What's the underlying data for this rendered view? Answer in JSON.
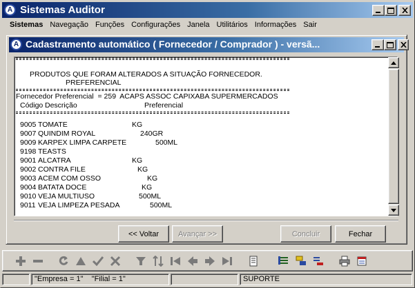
{
  "app": {
    "title": "Sistemas Auditor",
    "icon": "auditor-logo-icon"
  },
  "menu": [
    "Sistemas",
    "Navegação",
    "Funções",
    "Configurações",
    "Janela",
    "Utilitários",
    "Informações",
    "Sair"
  ],
  "child_window": {
    "title": "Cadastramento automático ( Fornecedor / Comprador ) - versã..."
  },
  "report": {
    "heading_line1": "PRODUTOS QUE FORAM ALTERADOS A SITUAÇÃO FORNECEDOR.",
    "heading_line2": "PREFERENCIAL",
    "supplier_line": "Fornecedor Preferencial  = 259  ACAPS ASSOC CAPIXABA SUPERMERCADOS",
    "columns": {
      "codigo": "Código",
      "descricao": "Descrição",
      "preferencial": "Preferencial"
    },
    "rows": [
      {
        "code": "9005",
        "desc": "TOMATE",
        "unit": "KG"
      },
      {
        "code": "9007",
        "desc": "QUINDIM ROYAL",
        "unit": "240GR"
      },
      {
        "code": "9009",
        "desc": "KARPEX LIMPA CARPETE",
        "unit": "500ML"
      },
      {
        "code": "9198",
        "desc": "TEASTS",
        "unit": ""
      },
      {
        "code": "9001",
        "desc": "ALCATRA",
        "unit": "KG"
      },
      {
        "code": "9002",
        "desc": "CONTRA FILE",
        "unit": "KG"
      },
      {
        "code": "9003",
        "desc": "ACEM COM OSSO",
        "unit": "KG"
      },
      {
        "code": "9004",
        "desc": "BATATA DOCE",
        "unit": "KG"
      },
      {
        "code": "9010",
        "desc": "VEJA MULTIUSO",
        "unit": "500ML"
      },
      {
        "code": "9011",
        "desc": "VEJA LIMPEZA PESADA",
        "unit": "500ML"
      }
    ]
  },
  "buttons": {
    "voltar": "<< Voltar",
    "avancar": "Avançar >>",
    "concluir": "Concluir",
    "fechar": "Fechar"
  },
  "status": {
    "empresa": "\"Empresa = 1\"",
    "filial": "\"Filial = 1\"",
    "user": "SUPORTE"
  },
  "colors": {
    "title_start": "#0a246a",
    "title_end": "#a6caf0",
    "face": "#d4d0c8"
  }
}
